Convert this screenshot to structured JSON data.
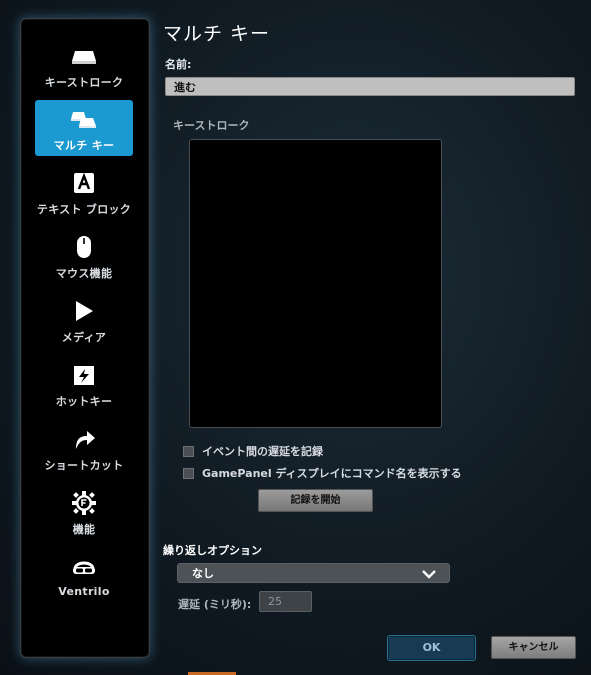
{
  "dialog": {
    "title": "マルチ キー"
  },
  "sidebar": {
    "items": [
      {
        "label": "キーストローク",
        "icon": "keycap-icon"
      },
      {
        "label": "マルチ キー",
        "icon": "multi-key-icon",
        "active": true
      },
      {
        "label": "テキスト ブロック",
        "icon": "text-block-icon"
      },
      {
        "label": "マウス機能",
        "icon": "mouse-icon"
      },
      {
        "label": "メディア",
        "icon": "play-icon"
      },
      {
        "label": "ホットキー",
        "icon": "hotkey-icon"
      },
      {
        "label": "ショートカット",
        "icon": "shortcut-arrow-icon"
      },
      {
        "label": "機能",
        "icon": "function-gear-icon"
      },
      {
        "label": "Ventrilo",
        "icon": "headset-icon"
      }
    ]
  },
  "name": {
    "label": "名前:",
    "value": "進む"
  },
  "keystroke": {
    "label": "キーストローク"
  },
  "options": {
    "record_delays": {
      "label": "イベント間の遅延を記録",
      "checked": false
    },
    "show_on_gamepanel": {
      "label": "GamePanel ディスプレイにコマンド名を表示する",
      "checked": false
    }
  },
  "record_button": {
    "label": "記録を開始"
  },
  "repeat": {
    "label": "繰り返しオプション",
    "selected": "なし",
    "delay_label": "遅延 (ミリ秒):",
    "delay_value": "25"
  },
  "footer": {
    "ok_label": "OK",
    "cancel_label": "キャンセル"
  },
  "colors": {
    "accent": "#1a9ad0",
    "ok_border": "#2c6f92"
  }
}
